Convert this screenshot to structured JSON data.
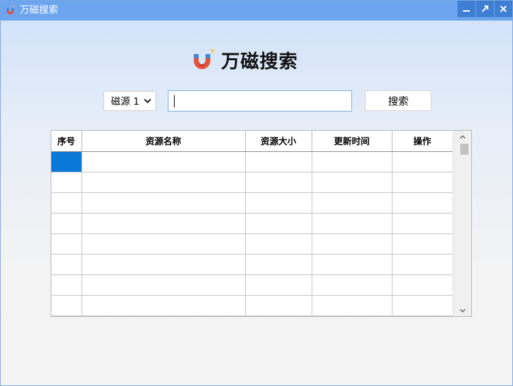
{
  "window": {
    "title": "万磁搜索",
    "title_icon": "magnet-icon",
    "buttons": [
      "minimize-icon",
      "maximize-icon",
      "close-icon"
    ]
  },
  "logo": {
    "icon": "magnet-icon",
    "text": "万磁搜索"
  },
  "search": {
    "source_selected": "磁源 1",
    "query_value": "",
    "button_label": "搜索"
  },
  "table": {
    "columns": [
      "序号",
      "资源名称",
      "资源大小",
      "更新时间",
      "操作"
    ],
    "rows": [
      [
        "",
        "",
        "",
        "",
        ""
      ],
      [
        "",
        "",
        "",
        "",
        ""
      ],
      [
        "",
        "",
        "",
        "",
        ""
      ],
      [
        "",
        "",
        "",
        "",
        ""
      ],
      [
        "",
        "",
        "",
        "",
        ""
      ],
      [
        "",
        "",
        "",
        "",
        ""
      ],
      [
        "",
        "",
        "",
        "",
        ""
      ],
      [
        "",
        "",
        "",
        "",
        ""
      ]
    ],
    "selected_cell": {
      "row": 0,
      "col": 0
    }
  },
  "colors": {
    "titlebar": "#6da5ef",
    "title_buttons": "#3f7fd3",
    "selection": "#0a78d7",
    "input_border": "#7fb0e0"
  }
}
